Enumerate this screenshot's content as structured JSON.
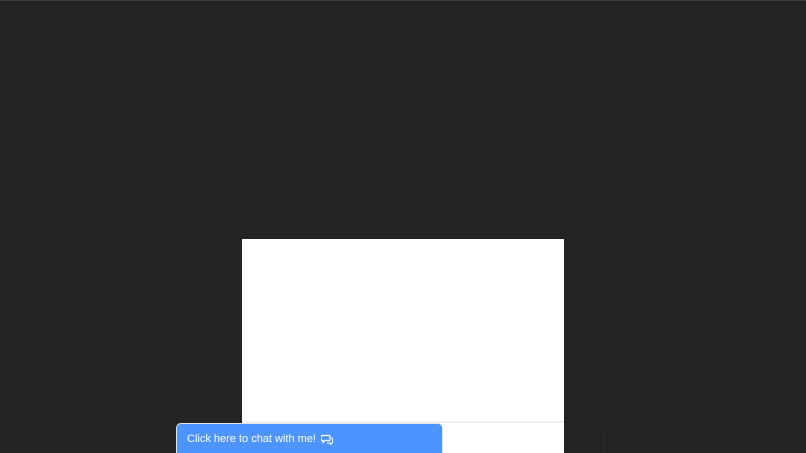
{
  "chat": {
    "label": "Click here to chat with me!",
    "icon": "speech-bubbles-icon",
    "accent": "#4d94ff"
  },
  "colors": {
    "background": "#232323",
    "panel": "#ffffff"
  }
}
